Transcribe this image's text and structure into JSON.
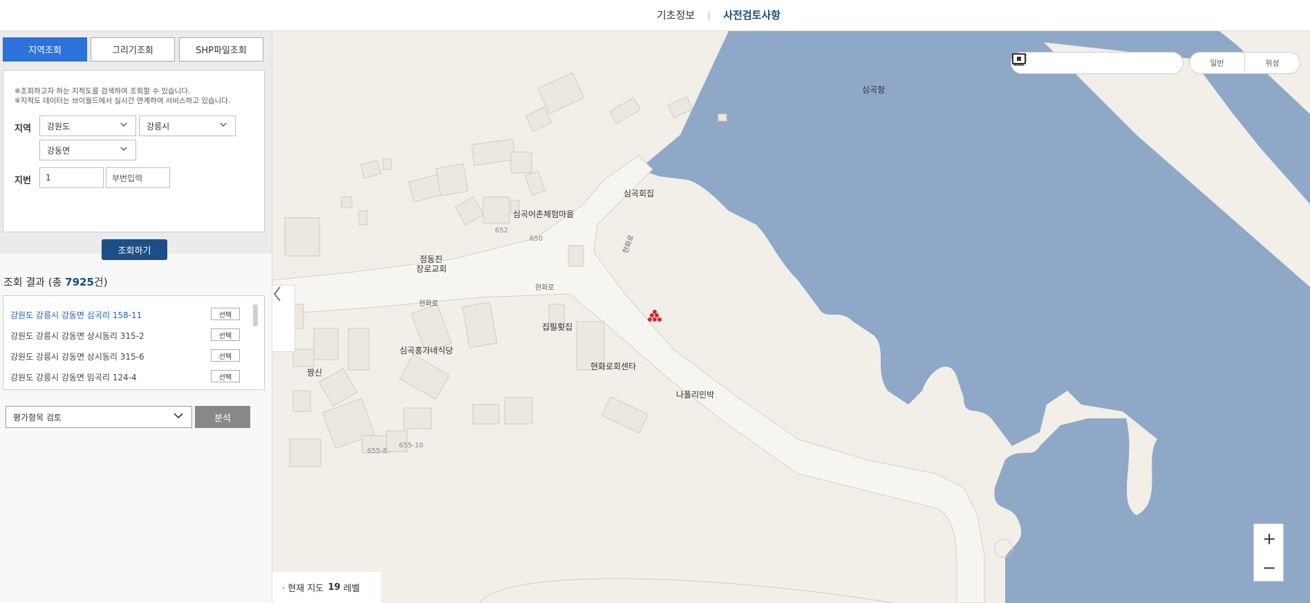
{
  "header": {
    "nav_basic": "기초정보",
    "nav_review": "사전검토사항",
    "separator": "|"
  },
  "tabs": [
    {
      "label": "지역조회",
      "active": true
    },
    {
      "label": "그리기조회",
      "active": false
    },
    {
      "label": "SHP파일조회",
      "active": false
    }
  ],
  "search": {
    "notice1": "※조회하고자 하는 지적도를 검색하여 조회할 수 있습니다.",
    "notice2": "※지적도 데이터는 브이월드에서 실시간 연계하여 서비스하고 있습니다.",
    "region_label": "지역",
    "province": "강원도",
    "city": "강릉시",
    "town": "강동면",
    "lot_label": "지번",
    "lot_main": "1",
    "lot_sub_placeholder": "부번입력",
    "button": "조회하기"
  },
  "results": {
    "title_prefix": "조회 결과 (총 ",
    "count": "7925",
    "title_suffix": "건)",
    "select_label": "선택",
    "items": [
      "강원도 강릉시 강동면 심곡리 158-11",
      "강원도 강릉시 강동면 상시동리 315-2",
      "강원도 강릉시 강동면 상시동리 315-6",
      "강원도 강릉시 강동면 임곡리 124-4"
    ]
  },
  "evaluation": {
    "selected": "평가항목 검토",
    "analyze_button": "분석"
  },
  "map": {
    "pois": {
      "simgok_port": "심곡항",
      "simgok_restaurant": "심곡회집",
      "village": "심곡어촌체험마을",
      "church_line1": "정동진",
      "church_line2": "장로교회",
      "jipfil": "집필횟집",
      "honga": "심곡홍가네식당",
      "jjangsin": "짱신",
      "hyeonhwaro_center": "현화로회센타",
      "napoli": "나폴리민박"
    },
    "roads": {
      "r1": "현화로",
      "r2": "현화로",
      "r3": "현화로"
    },
    "lots": {
      "l652": "652",
      "l650": "650",
      "l6558": "655-8",
      "l65510": "655-10"
    },
    "type_normal": "일반",
    "type_satellite": "위성",
    "zoom_in": "+",
    "zoom_out": "−",
    "level_prefix": "· 현재 지도",
    "level_value": "19",
    "level_suffix": "레벨",
    "colors": {
      "water": "#8fa8c8",
      "land": "#f2eee8",
      "road": "#f5f5f3",
      "marker": "#e0202a"
    }
  }
}
